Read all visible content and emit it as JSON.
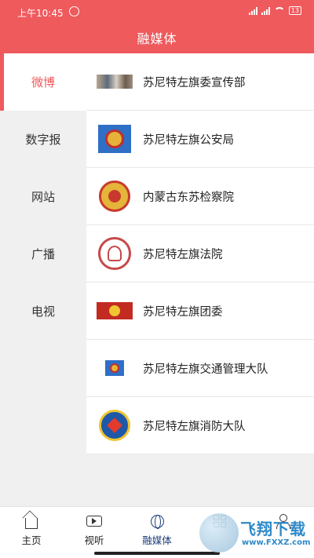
{
  "status_bar": {
    "time": "上午10:45",
    "battery": "13"
  },
  "header": {
    "title": "融媒体"
  },
  "sidebar": {
    "items": [
      {
        "label": "微博",
        "active": true
      },
      {
        "label": "数字报",
        "active": false
      },
      {
        "label": "网站",
        "active": false
      },
      {
        "label": "广播",
        "active": false
      },
      {
        "label": "电视",
        "active": false
      }
    ]
  },
  "accounts": [
    {
      "label": "苏尼特左旗委宣传部",
      "icon": "photo-icon"
    },
    {
      "label": "苏尼特左旗公安局",
      "icon": "police-badge-icon"
    },
    {
      "label": "内蒙古东苏检察院",
      "icon": "procuratorate-emblem-icon"
    },
    {
      "label": "苏尼特左旗法院",
      "icon": "court-emblem-icon"
    },
    {
      "label": "苏尼特左旗团委",
      "icon": "youth-league-icon"
    },
    {
      "label": "苏尼特左旗交通管理大队",
      "icon": "traffic-police-icon"
    },
    {
      "label": "苏尼特左旗消防大队",
      "icon": "fire-rescue-icon"
    }
  ],
  "tabbar": {
    "tabs": [
      {
        "label": "主页",
        "icon": "home-icon"
      },
      {
        "label": "视听",
        "icon": "video-icon"
      },
      {
        "label": "融媒体",
        "icon": "globe-icon",
        "active": true
      },
      {
        "label": "",
        "icon": "grid-icon"
      },
      {
        "label": "",
        "icon": "user-icon"
      }
    ]
  },
  "watermark": {
    "text": "飞翔下载",
    "url": "www.FXXZ.com"
  },
  "colors": {
    "accent": "#ef5a5d",
    "active_tab": "#1d3c7a"
  }
}
